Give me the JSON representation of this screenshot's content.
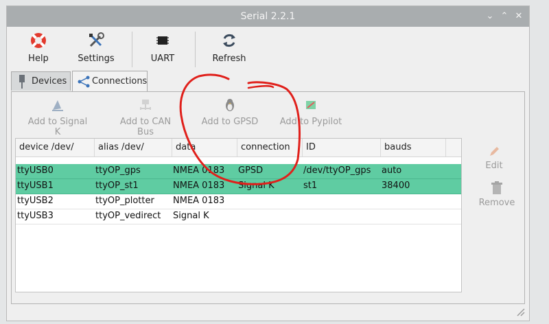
{
  "window": {
    "title": "Serial 2.2.1"
  },
  "toolbar": {
    "help": "Help",
    "settings": "Settings",
    "uart": "UART",
    "refresh": "Refresh"
  },
  "tabs": [
    {
      "label": "Devices",
      "active": false
    },
    {
      "label": "Connections",
      "active": true
    }
  ],
  "actions": {
    "signalk": "Add to Signal K",
    "canbus": "Add to CAN Bus",
    "gpsd": "Add to GPSD",
    "pypilot": "Add to Pypilot"
  },
  "table": {
    "headers": [
      "device /dev/",
      "alias /dev/",
      "data",
      "connection",
      "ID",
      "bauds"
    ],
    "rows": [
      {
        "device": "ttyUSB0",
        "alias": "ttyOP_gps",
        "data": "NMEA 0183",
        "connection": "GPSD",
        "id": "/dev/ttyOP_gps",
        "bauds": "auto",
        "selected": true
      },
      {
        "device": "ttyUSB1",
        "alias": "ttyOP_st1",
        "data": "NMEA 0183",
        "connection": "Signal K",
        "id": "st1",
        "bauds": "38400",
        "selected": true
      },
      {
        "device": "ttyUSB2",
        "alias": "ttyOP_plotter",
        "data": "NMEA 0183",
        "connection": "",
        "id": "",
        "bauds": "",
        "selected": false
      },
      {
        "device": "ttyUSB3",
        "alias": "ttyOP_vedirect",
        "data": "Signal K",
        "connection": "",
        "id": "",
        "bauds": "",
        "selected": false
      }
    ]
  },
  "side": {
    "edit": "Edit",
    "remove": "Remove"
  },
  "colors": {
    "selection": "#5fcca2",
    "annotation": "#e0201b",
    "titlebar": "#a9adaf"
  }
}
